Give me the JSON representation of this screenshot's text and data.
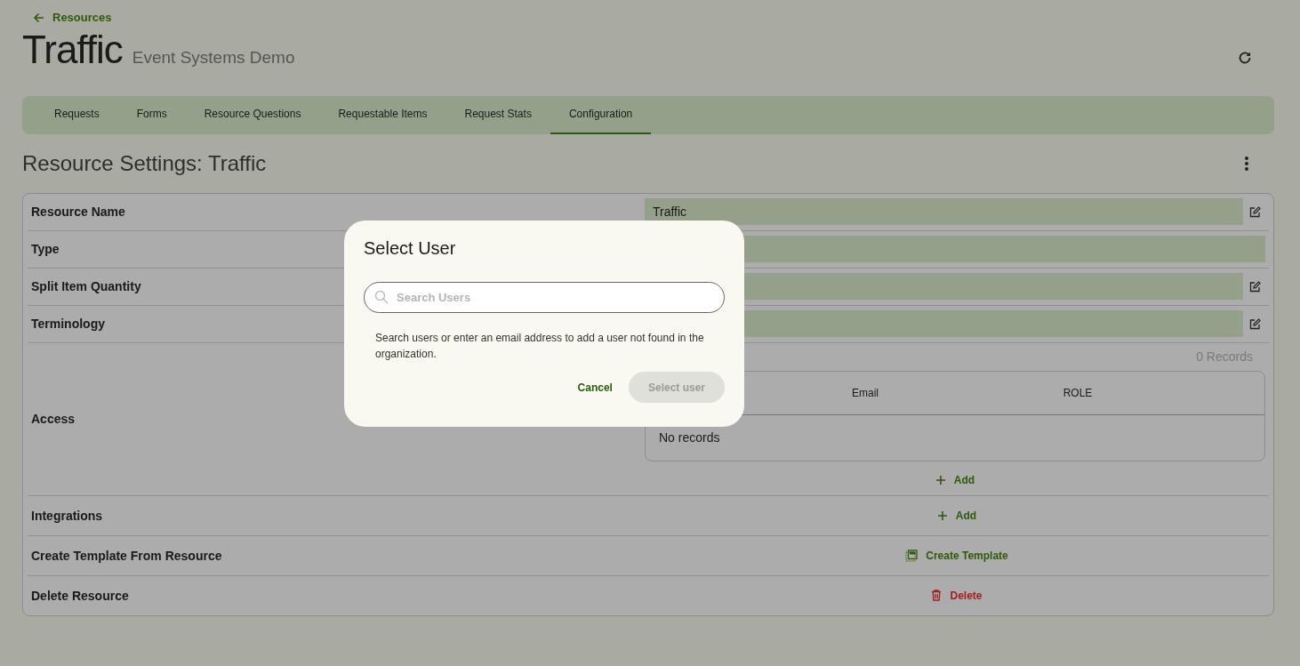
{
  "back_link": "Resources",
  "title": "Traffic",
  "subtitle": "Event Systems Demo",
  "tabs": [
    {
      "label": "Requests",
      "selected": false
    },
    {
      "label": "Forms",
      "selected": false
    },
    {
      "label": "Resource Questions",
      "selected": false
    },
    {
      "label": "Requestable Items",
      "selected": false
    },
    {
      "label": "Request Stats",
      "selected": false
    },
    {
      "label": "Configuration",
      "selected": true
    }
  ],
  "section_title": "Resource Settings: Traffic",
  "settings": [
    {
      "kind": "field",
      "label": "Resource Name",
      "value": "Traffic",
      "editable": true
    },
    {
      "kind": "field",
      "label": "Type",
      "editable": false
    },
    {
      "kind": "field",
      "label": "Split Item Quantity",
      "editable": true
    },
    {
      "kind": "field",
      "label": "Terminology",
      "editable": true
    },
    {
      "kind": "access",
      "label": "Access",
      "records": "0 Records",
      "columns": [
        "Email",
        "ROLE"
      ],
      "empty": "No records",
      "action": {
        "kind": "add",
        "label": "Add"
      }
    },
    {
      "kind": "action",
      "label": "Integrations",
      "action": {
        "kind": "add",
        "label": "Add"
      }
    },
    {
      "kind": "action",
      "label": "Create Template From Resource",
      "action": {
        "kind": "template",
        "label": "Create Template"
      }
    },
    {
      "kind": "action",
      "label": "Delete Resource",
      "action": {
        "kind": "delete",
        "label": "Delete"
      }
    }
  ],
  "dialog": {
    "title": "Select User",
    "search": {
      "placeholder": "Search Users"
    },
    "help": "Search users or enter an email address to add a user not found in the organization.",
    "buttons": [
      {
        "kind": "text",
        "label": "Cancel",
        "disabled": false
      },
      {
        "kind": "filled",
        "label": "Select user",
        "disabled": true
      }
    ]
  }
}
